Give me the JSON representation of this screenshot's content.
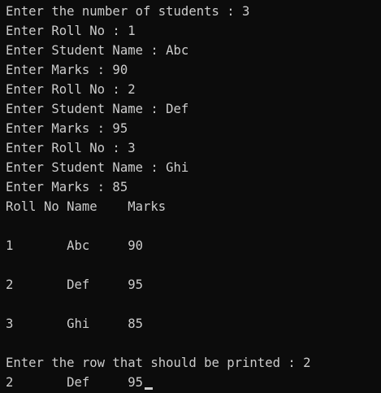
{
  "console": {
    "lines": [
      "Enter the number of students : 3",
      "Enter Roll No : 1",
      "Enter Student Name : Abc",
      "Enter Marks : 90",
      "Enter Roll No : 2",
      "Enter Student Name : Def",
      "Enter Marks : 95",
      "Enter Roll No : 3",
      "Enter Student Name : Ghi",
      "Enter Marks : 85",
      "Roll No Name    Marks",
      "",
      "1       Abc     90",
      "",
      "2       Def     95",
      "",
      "3       Ghi     85",
      "",
      "Enter the row that should be printed : 2",
      "2       Def     95"
    ],
    "text_color": "#cccccc",
    "background_color": "#0c0c0c"
  }
}
